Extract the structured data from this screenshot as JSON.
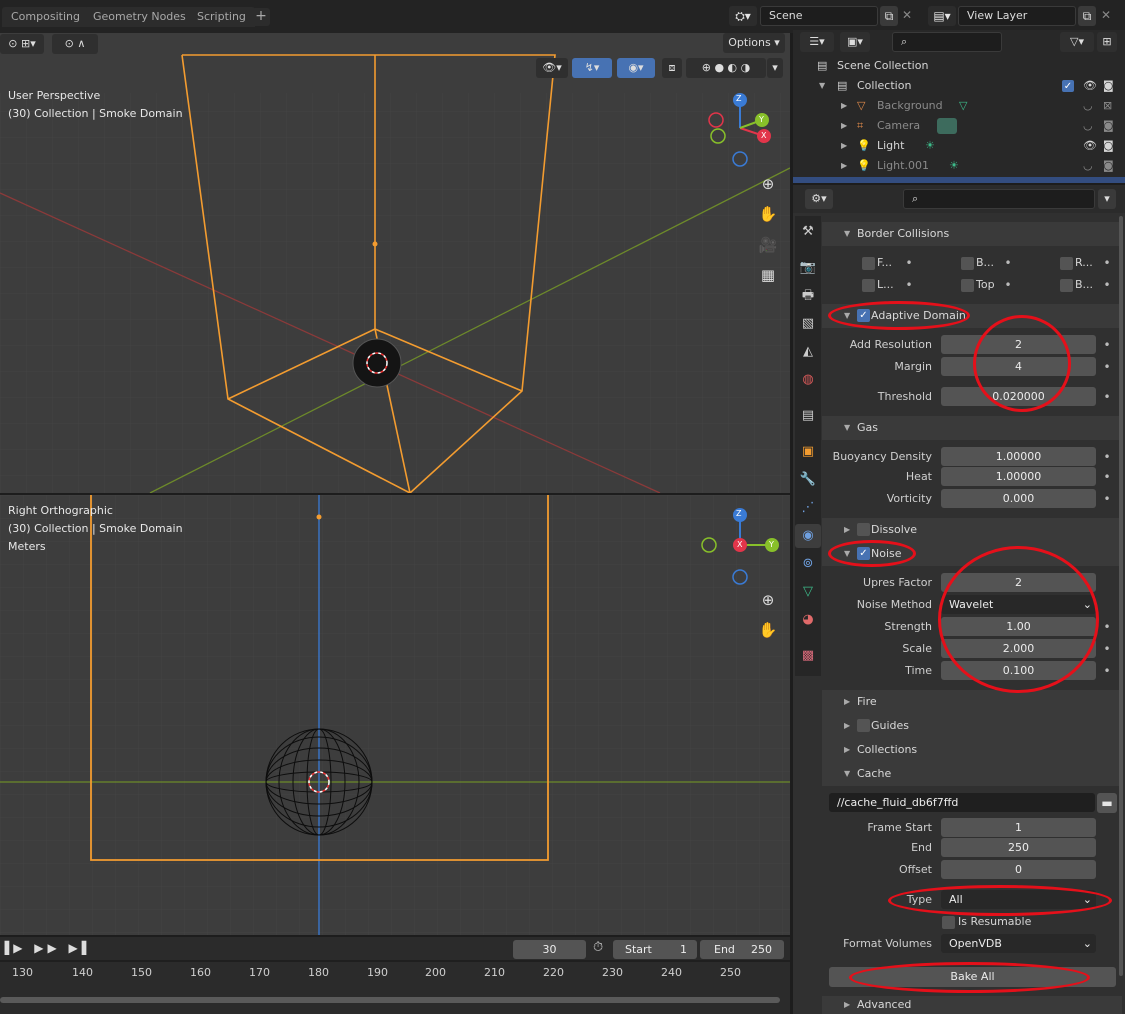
{
  "workspace_tabs": [
    "Compositing",
    "Geometry Nodes",
    "Scripting"
  ],
  "add_tab": "+",
  "scene": {
    "name": "Scene",
    "view_layer": "View Layer"
  },
  "viewport_top": {
    "mode": "User Perspective",
    "info": "(30) Collection | Smoke Domain",
    "options": "Options"
  },
  "viewport_bottom": {
    "mode": "Right Orthographic",
    "info": "(30) Collection | Smoke Domain",
    "units": "Meters"
  },
  "gizmo": {
    "z": "Z",
    "y": "Y",
    "x": "X"
  },
  "outliner": {
    "root": "Scene Collection",
    "collection": "Collection",
    "items": [
      {
        "label": "Background",
        "dim": true
      },
      {
        "label": "Camera",
        "dim": true
      },
      {
        "label": "Light",
        "dim": false
      },
      {
        "label": "Light.001",
        "dim": true
      }
    ]
  },
  "properties": {
    "border_collisions": {
      "title": "Border Collisions",
      "items": [
        "F...",
        "B...",
        "R...",
        "L...",
        "Top",
        "B..."
      ]
    },
    "adaptive_domain": {
      "title": "Adaptive Domain",
      "add_resolution_label": "Add Resolution",
      "add_resolution": "2",
      "margin_label": "Margin",
      "margin": "4",
      "threshold_label": "Threshold",
      "threshold": "0.020000"
    },
    "gas": {
      "title": "Gas",
      "buoyancy_label": "Buoyancy Density",
      "buoyancy": "1.00000",
      "heat_label": "Heat",
      "heat": "1.00000",
      "vorticity_label": "Vorticity",
      "vorticity": "0.000"
    },
    "dissolve": {
      "title": "Dissolve"
    },
    "noise": {
      "title": "Noise",
      "upres_label": "Upres Factor",
      "upres": "2",
      "method_label": "Noise Method",
      "method": "Wavelet",
      "strength_label": "Strength",
      "strength": "1.00",
      "scale_label": "Scale",
      "scale": "2.000",
      "time_label": "Time",
      "time": "0.100"
    },
    "fire": {
      "title": "Fire"
    },
    "guides": {
      "title": "Guides"
    },
    "collections": {
      "title": "Collections"
    },
    "cache": {
      "title": "Cache",
      "path": "//cache_fluid_db6f7ffd",
      "frame_start_label": "Frame Start",
      "frame_start": "1",
      "end_label": "End",
      "end": "250",
      "offset_label": "Offset",
      "offset": "0",
      "type_label": "Type",
      "type": "All",
      "resumable_label": "Is Resumable",
      "format_label": "Format Volumes",
      "format": "OpenVDB",
      "bake_label": "Bake All"
    },
    "advanced": {
      "title": "Advanced"
    }
  },
  "timeline": {
    "current_frame": "30",
    "start_label": "Start",
    "start": "1",
    "end_label": "End",
    "end": "250",
    "ticks": [
      "130",
      "140",
      "150",
      "160",
      "170",
      "180",
      "190",
      "200",
      "210",
      "220",
      "230",
      "240",
      "250"
    ]
  },
  "colors": {
    "accent": "#4772b3",
    "selection_orange": "#f39c30",
    "annotation_red": "#e5101a"
  }
}
